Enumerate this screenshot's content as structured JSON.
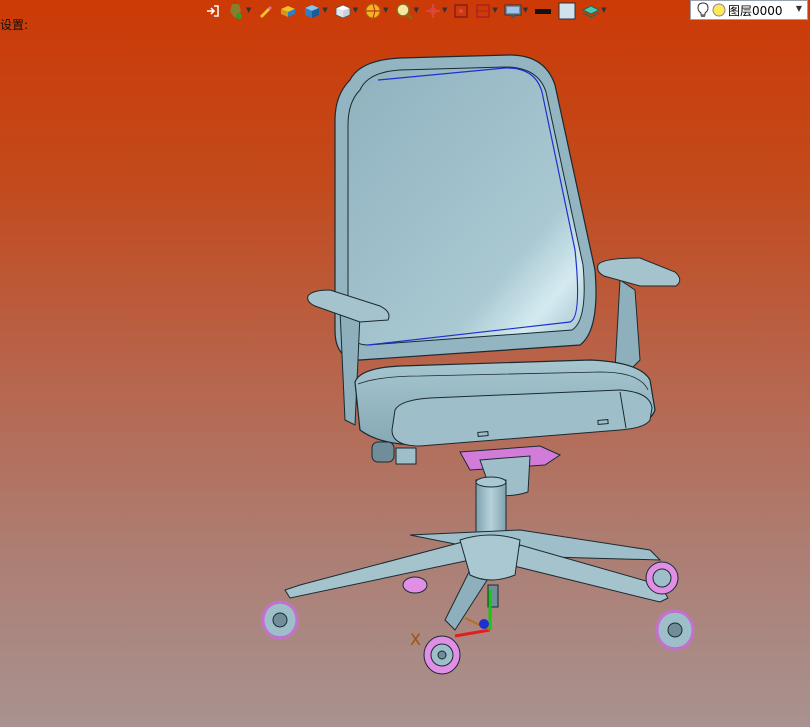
{
  "toolbar": {
    "items": [
      {
        "name": "exit-icon"
      },
      {
        "name": "snap-icon"
      },
      {
        "name": "pencil-icon"
      },
      {
        "name": "box-icon"
      },
      {
        "name": "cube-icon"
      },
      {
        "name": "view-cube-icon"
      },
      {
        "name": "render-style-icon"
      },
      {
        "name": "zoom-icon"
      },
      {
        "name": "pan-icon"
      },
      {
        "name": "frame-icon"
      },
      {
        "name": "section-icon"
      },
      {
        "name": "display-icon"
      },
      {
        "name": "line-color-icon"
      },
      {
        "name": "fill-color-icon"
      },
      {
        "name": "layer-stack-icon"
      }
    ],
    "layer_name": "图层0000"
  },
  "viewport": {
    "settings_label": "设置:",
    "axis_x_label": "X",
    "background_top": "#cc3a06",
    "background_bottom": "#a89290",
    "model_color": "#9ebfca",
    "caster_color": "#e08ee6"
  }
}
